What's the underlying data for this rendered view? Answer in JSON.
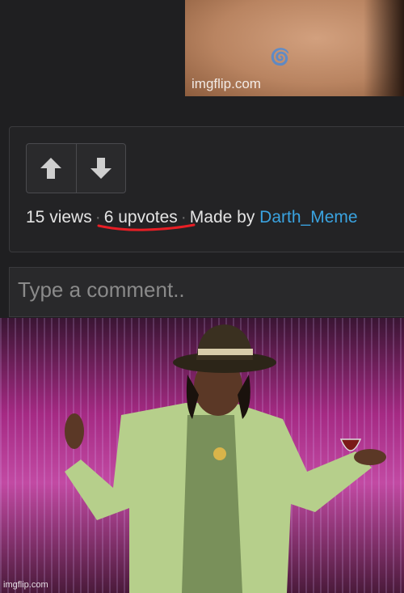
{
  "top_image": {
    "watermark": "imgflip.com"
  },
  "stats": {
    "views": "15 views",
    "upvotes": "6 upvotes",
    "made_by": "Made by",
    "author": "Darth_Meme"
  },
  "comment": {
    "placeholder": "Type a comment.."
  },
  "photo": {
    "watermark": "imgflip.com"
  },
  "colors": {
    "author_link": "#3aa3e0",
    "annotation": "#e81e25",
    "background": "#1f1f21"
  },
  "icons": [
    "upvote-arrow-icon",
    "downvote-arrow-icon",
    "imgflip-swirl-icon"
  ]
}
